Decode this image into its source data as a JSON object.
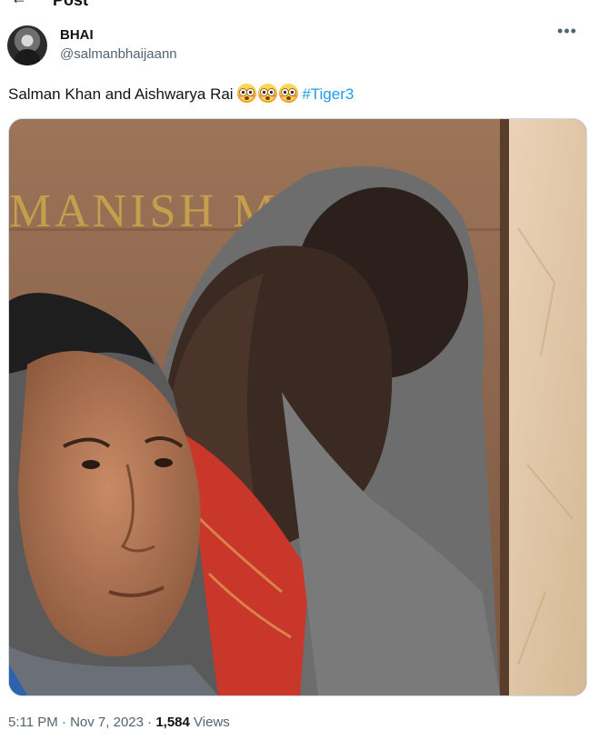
{
  "top_bar": {
    "title_fragment": "Post"
  },
  "author": {
    "display_name": "BHAI",
    "handle": "@salmanbhaijaann"
  },
  "tweet": {
    "text": "Salman Khan and Aishwarya Rai ",
    "emojis": [
      "flushed-face",
      "flushed-face",
      "flushed-face"
    ],
    "hashtag": "#Tiger3"
  },
  "media": {
    "sign_text": "MANISH MALH"
  },
  "meta": {
    "time": "5:11 PM",
    "separator1": " · ",
    "date": "Nov 7, 2023",
    "separator2": " · ",
    "views_count": "1,584",
    "views_label": " Views"
  },
  "colors": {
    "link": "#1d9bf0",
    "secondary_text": "#536471",
    "primary_text": "#0f1419",
    "border": "#cfd9de"
  }
}
